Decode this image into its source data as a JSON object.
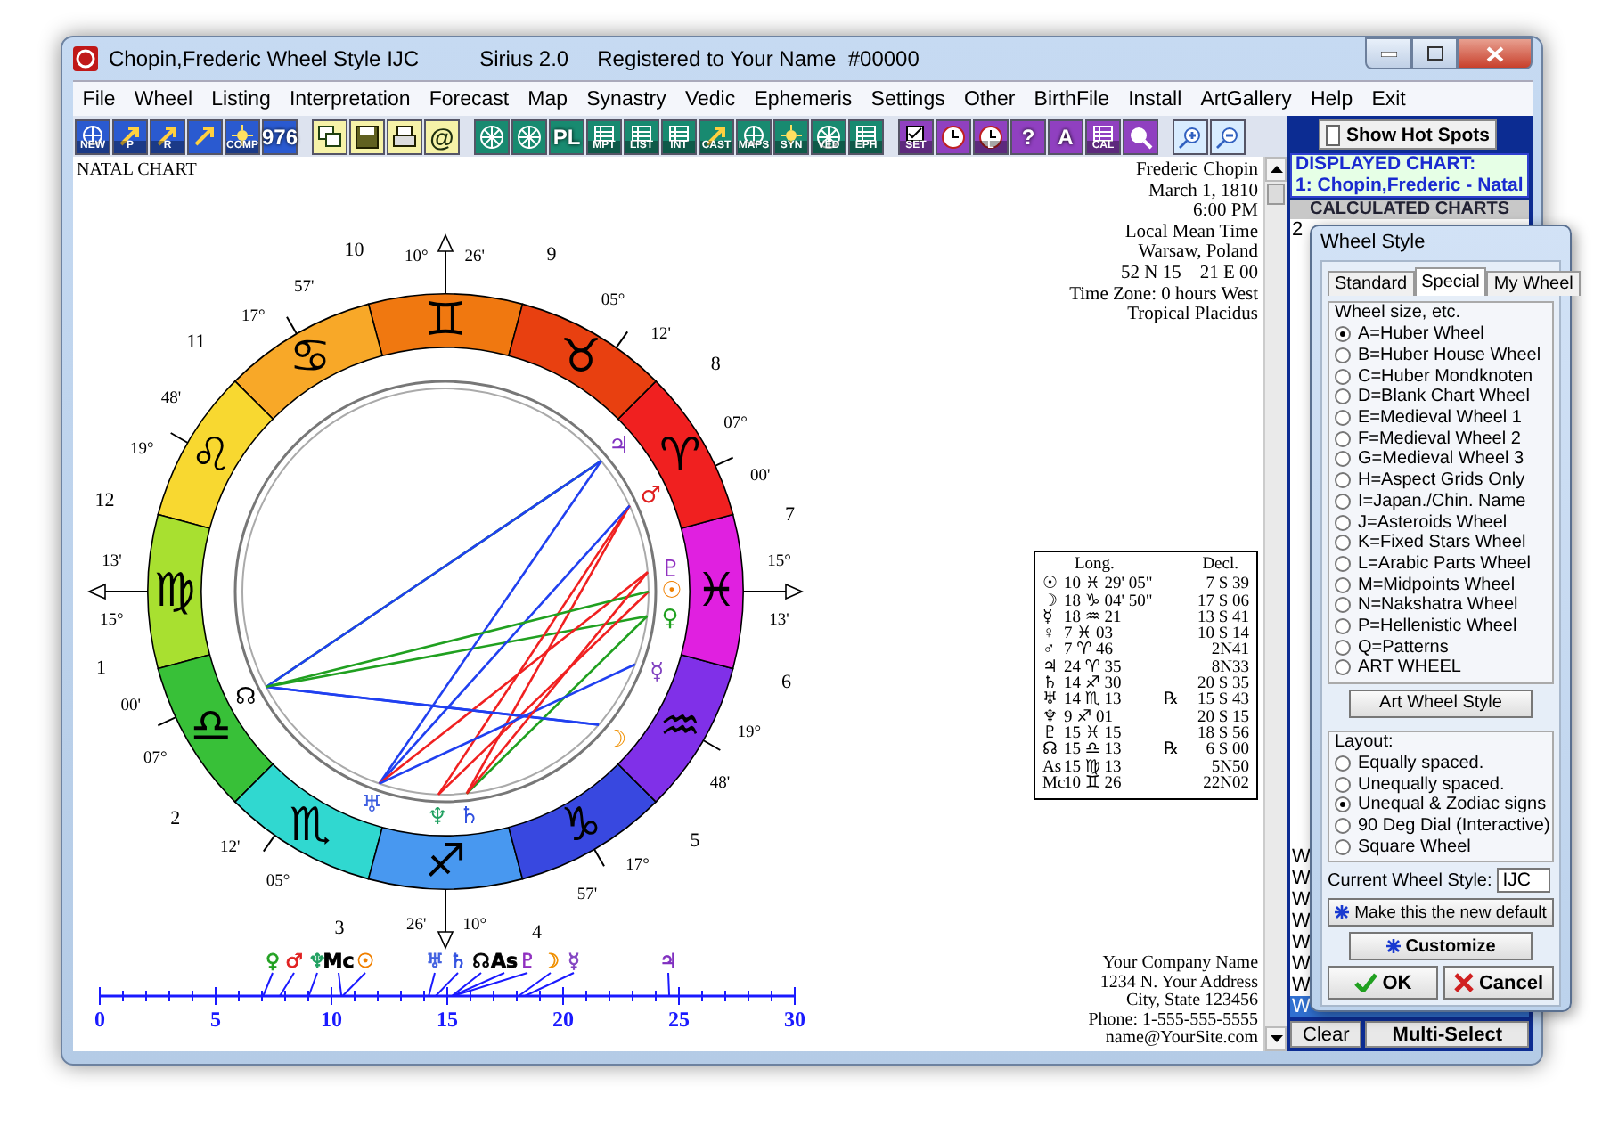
{
  "window": {
    "title": "Chopin,Frederic Wheel Style IJC",
    "product": "Sirius 2.0",
    "registration": "Registered to Your Name  #00000"
  },
  "menu": [
    "File",
    "Wheel",
    "Listing",
    "Interpretation",
    "Forecast",
    "Map",
    "Synastry",
    "Vedic",
    "Ephemeris",
    "Settings",
    "Other",
    "BirthFile",
    "Install",
    "ArtGallery",
    "Help",
    "Exit"
  ],
  "toolbar": [
    {
      "color": "#2a5ad0",
      "kind": "globe",
      "label": "NEW"
    },
    {
      "color": "#2a5ad0",
      "kind": "arrow",
      "label": "P"
    },
    {
      "color": "#2a5ad0",
      "kind": "arrow",
      "label": "R"
    },
    {
      "color": "#2a5ad0",
      "kind": "arrow"
    },
    {
      "color": "#2a5ad0",
      "kind": "sun",
      "label": "COMP"
    },
    {
      "color": "#2a5ad0",
      "kind": "plain",
      "label": "976"
    },
    {
      "color": "#f6f2a8",
      "kind": "windows"
    },
    {
      "color": "#f6f2a8",
      "kind": "save"
    },
    {
      "color": "#f6f2a8",
      "kind": "printer"
    },
    {
      "color": "#f6f2a8",
      "kind": "plain",
      "label": "@"
    },
    {
      "color": "#188a70",
      "kind": "wheel"
    },
    {
      "color": "#188a70",
      "kind": "wheel"
    },
    {
      "color": "#188a70",
      "kind": "plain",
      "label": "PL"
    },
    {
      "color": "#188a70",
      "kind": "grid",
      "label": "MPT"
    },
    {
      "color": "#188a70",
      "kind": "grid",
      "label": "LIST"
    },
    {
      "color": "#188a70",
      "kind": "grid",
      "label": "INT"
    },
    {
      "color": "#188a70",
      "kind": "arrow",
      "label": "CAST"
    },
    {
      "color": "#188a70",
      "kind": "globe",
      "label": "MAPS"
    },
    {
      "color": "#188a70",
      "kind": "sun",
      "label": "SYN"
    },
    {
      "color": "#188a70",
      "kind": "wheel",
      "label": "VED"
    },
    {
      "color": "#188a70",
      "kind": "grid",
      "label": "EPH"
    },
    {
      "color": "#9040c0",
      "kind": "check",
      "label": "SET"
    },
    {
      "color": "#9040c0",
      "kind": "clock"
    },
    {
      "color": "#9040c0",
      "kind": "clock",
      "label": "L"
    },
    {
      "color": "#9040c0",
      "kind": "plain",
      "label": "?"
    },
    {
      "color": "#9040c0",
      "kind": "plain",
      "label": "A"
    },
    {
      "color": "#9040c0",
      "kind": "grid",
      "label": "CAL"
    },
    {
      "color": "#9040c0",
      "kind": "magnifier"
    },
    {
      "color": "#d8ecff",
      "kind": "zoom-in"
    },
    {
      "color": "#d8ecff",
      "kind": "zoom-out"
    }
  ],
  "hot_spots": {
    "label": "Show Hot Spots",
    "checked": false
  },
  "chart": {
    "heading": "NATAL CHART",
    "birth_info": [
      "Frederic Chopin",
      "March 1, 1810",
      "6:00 PM",
      "Local Mean Time",
      "Warsaw, Poland",
      "52 N 15    21 E 00",
      "Time Zone: 0 hours West",
      "Tropical Placidus"
    ],
    "signs": [
      {
        "glyph": "♊",
        "color": "#f07810"
      },
      {
        "glyph": "♋",
        "color": "#f8a828"
      },
      {
        "glyph": "♌",
        "color": "#f8d830"
      },
      {
        "glyph": "♍",
        "color": "#a8e030"
      },
      {
        "glyph": "♎",
        "color": "#38c038"
      },
      {
        "glyph": "♏",
        "color": "#30d8d0"
      },
      {
        "glyph": "♐",
        "color": "#4898f0"
      },
      {
        "glyph": "♑",
        "color": "#3848e0"
      },
      {
        "glyph": "♒",
        "color": "#8030e8"
      },
      {
        "glyph": "♓",
        "color": "#e020e0"
      },
      {
        "glyph": "♈",
        "color": "#f02020"
      },
      {
        "glyph": "♉",
        "color": "#e84010"
      }
    ],
    "house_numbers": [
      "10",
      "11",
      "12",
      "1",
      "2",
      "3",
      "4",
      "5",
      "6",
      "7",
      "8",
      "9"
    ],
    "cusps": [
      {
        "deg": "10°",
        "min": "26'"
      },
      {
        "deg": "17°",
        "min": "57'"
      },
      {
        "deg": "19°",
        "min": "48'"
      },
      {
        "deg": "15°",
        "min": "13'"
      },
      {
        "deg": "07°",
        "min": "00'"
      },
      {
        "deg": "05°",
        "min": "12'"
      },
      {
        "deg": "10°",
        "min": "26'"
      },
      {
        "deg": "17°",
        "min": "57'"
      },
      {
        "deg": "19°",
        "min": "48'"
      },
      {
        "deg": "15°",
        "min": "13'"
      },
      {
        "deg": "07°",
        "min": "00'"
      },
      {
        "deg": "05°",
        "min": "12'"
      }
    ],
    "planets": [
      {
        "glyph": "♃",
        "color": "#8030c0"
      },
      {
        "glyph": "♂",
        "color": "#e02020"
      },
      {
        "glyph": "♇",
        "color": "#9030c0"
      },
      {
        "glyph": "☉",
        "color": "#f08000"
      },
      {
        "glyph": "♀",
        "color": "#20a020"
      },
      {
        "glyph": "☿",
        "color": "#8040c0"
      },
      {
        "glyph": "☽",
        "color": "#f09000"
      },
      {
        "glyph": "♄",
        "color": "#3050e0"
      },
      {
        "glyph": "♆",
        "color": "#20a060"
      },
      {
        "glyph": "♅",
        "color": "#4060e0"
      },
      {
        "glyph": "☊",
        "color": "#000000"
      }
    ],
    "positions": {
      "headers": [
        "Long.",
        "Decl."
      ],
      "rows": [
        {
          "glyph": "☉",
          "long": "10 ♓ 29' 05\"",
          "decl": "7 S 39"
        },
        {
          "glyph": "☽",
          "long": "18 ♑ 04' 50\"",
          "decl": "17 S 06"
        },
        {
          "glyph": "☿",
          "long": "18 ♒ 21",
          "decl": "13 S 41"
        },
        {
          "glyph": "♀",
          "long": "7 ♓ 03",
          "decl": "10 S 14"
        },
        {
          "glyph": "♂",
          "long": "7 ♈ 46",
          "decl": "2N41"
        },
        {
          "glyph": "♃",
          "long": "24 ♈ 35",
          "decl": "8N33"
        },
        {
          "glyph": "♄",
          "long": "14 ♐ 30",
          "decl": "20 S 35"
        },
        {
          "glyph": "♅",
          "long": "14 ♏ 13",
          "retro": "℞",
          "decl": "15 S 43"
        },
        {
          "glyph": "♆",
          "long": "9 ♐ 01",
          "decl": "20 S 15"
        },
        {
          "glyph": "♇",
          "long": "15 ♓ 15",
          "decl": "18 S 56"
        },
        {
          "glyph": "☊",
          "long": "15 ♎ 13",
          "retro": "℞",
          "decl": "6 S 00"
        },
        {
          "glyph": "As",
          "long": "15 ♍ 13",
          "decl": "5N50"
        },
        {
          "glyph": "Mc",
          "long": "10 ♊ 26",
          "decl": "22N02"
        }
      ]
    },
    "scale": {
      "labels": [
        "0",
        "5",
        "10",
        "15",
        "20",
        "25",
        "30"
      ],
      "markers": [
        {
          "glyph": "♀",
          "color": "#20a020"
        },
        {
          "glyph": "♂",
          "color": "#e02020"
        },
        {
          "glyph": "♆",
          "color": "#20a060"
        },
        {
          "glyph": "Mc",
          "color": "#000000"
        },
        {
          "glyph": "☉",
          "color": "#f08000"
        },
        {
          "glyph": "♅",
          "color": "#4060e0"
        },
        {
          "glyph": "♄",
          "color": "#3050e0"
        },
        {
          "glyph": "☊",
          "color": "#000000"
        },
        {
          "glyph": "As",
          "color": "#000000"
        },
        {
          "glyph": "♇",
          "color": "#9030c0"
        },
        {
          "glyph": "☽",
          "color": "#f09000"
        },
        {
          "glyph": "☿",
          "color": "#8040c0"
        },
        {
          "glyph": "♃",
          "color": "#8030c0"
        }
      ]
    },
    "footer": [
      "Your Company Name",
      "1234 N. Your Address",
      "City, State 123456",
      "Phone: 1-555-555-5555",
      "name@YourSite.com"
    ]
  },
  "displayed_chart": {
    "heading": "DISPLAYED CHART:",
    "value": "1: Chopin,Frederic - Natal"
  },
  "calculated_charts": {
    "heading": "CALCULATED CHARTS",
    "items": [
      {
        "text": "2",
        "selected": false
      },
      {
        "text": "W",
        "selected": false
      },
      {
        "text": "W",
        "selected": false
      },
      {
        "text": "W",
        "selected": false
      },
      {
        "text": "W",
        "selected": false
      },
      {
        "text": "W",
        "selected": false
      },
      {
        "text": "W",
        "selected": false
      },
      {
        "text": "W",
        "selected": false
      },
      {
        "text": "W",
        "selected": true
      }
    ]
  },
  "bottom_buttons": [
    "Clear",
    "Multi-Select"
  ],
  "dialog": {
    "title": "Wheel Style",
    "tabs": [
      {
        "label": "Standard",
        "selected": false
      },
      {
        "label": "Special",
        "selected": true
      },
      {
        "label": "My Wheel",
        "selected": false
      }
    ],
    "size_group": {
      "title": "Wheel size, etc.",
      "options": [
        {
          "label": "A=Huber Wheel",
          "selected": true
        },
        {
          "label": "B=Huber House Wheel",
          "selected": false
        },
        {
          "label": "C=Huber Mondknoten",
          "selected": false
        },
        {
          "label": "D=Blank Chart Wheel",
          "selected": false
        },
        {
          "label": "E=Medieval Wheel 1",
          "selected": false
        },
        {
          "label": "F=Medieval Wheel 2",
          "selected": false
        },
        {
          "label": "G=Medieval Wheel 3",
          "selected": false
        },
        {
          "label": "H=Aspect Grids Only",
          "selected": false
        },
        {
          "label": "I=Japan./Chin. Name",
          "selected": false
        },
        {
          "label": "J=Asteroids Wheel",
          "selected": false
        },
        {
          "label": "K=Fixed Stars Wheel",
          "selected": false
        },
        {
          "label": "L=Arabic Parts Wheel",
          "selected": false
        },
        {
          "label": "M=Midpoints Wheel",
          "selected": false
        },
        {
          "label": "N=Nakshatra Wheel",
          "selected": false
        },
        {
          "label": "P=Hellenistic Wheel",
          "selected": false
        },
        {
          "label": "Q=Patterns",
          "selected": false
        },
        {
          "label": "ART WHEEL",
          "selected": false
        }
      ]
    },
    "art_button": "Art Wheel Style",
    "layout_group": {
      "title": "Layout:",
      "options": [
        {
          "label": "Equally spaced.",
          "selected": false
        },
        {
          "label": "Unequally spaced.",
          "selected": false
        },
        {
          "label": "Unequal & Zodiac signs",
          "selected": true
        },
        {
          "label": "90 Deg Dial (Interactive)",
          "selected": false
        },
        {
          "label": "Square Wheel",
          "selected": false
        }
      ]
    },
    "current_style": {
      "label": "Current Wheel Style:",
      "value": "IJC"
    },
    "default_button": "Make this the new default",
    "customize_button": "Customize",
    "ok": "OK",
    "cancel": "Cancel"
  }
}
